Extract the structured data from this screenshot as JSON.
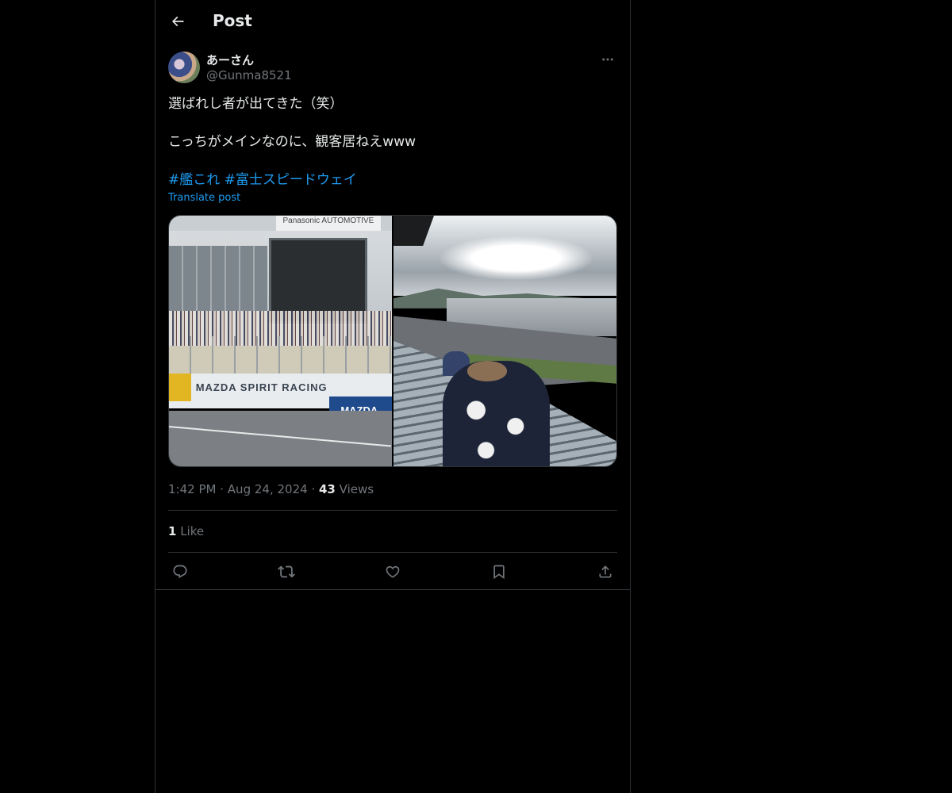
{
  "header": {
    "title": "Post",
    "back_icon": "arrow-left-icon"
  },
  "author": {
    "display_name": "あーさん",
    "handle": "@Gunma8521",
    "more_icon": "more-horizontal-icon"
  },
  "post": {
    "lines": [
      "選ばれし者が出てきた（笑）",
      "こっちがメインなのに、観客居ねえwww"
    ],
    "hashtags": [
      "#艦これ",
      "#富士スピードウェイ"
    ],
    "translate_label": "Translate post"
  },
  "media": {
    "photo1": {
      "sign_text": "Panasonic AUTOMOTIVE",
      "banner_text": "MAZDA SPIRIT RACING",
      "banner_blue_text": "MAZDA"
    }
  },
  "meta": {
    "time": "1:42 PM",
    "separator": "·",
    "date": "Aug 24, 2024",
    "views_count": "43",
    "views_label": "Views"
  },
  "likes": {
    "count": "1",
    "label": "Like"
  },
  "actions": {
    "reply_icon": "reply-icon",
    "repost_icon": "repost-icon",
    "like_icon": "heart-icon",
    "bookmark_icon": "bookmark-icon",
    "share_icon": "share-icon"
  },
  "colors": {
    "background": "#000000",
    "text": "#e7e9ea",
    "muted": "#71767b",
    "accent": "#1d9bf0",
    "border": "#2f3336"
  }
}
